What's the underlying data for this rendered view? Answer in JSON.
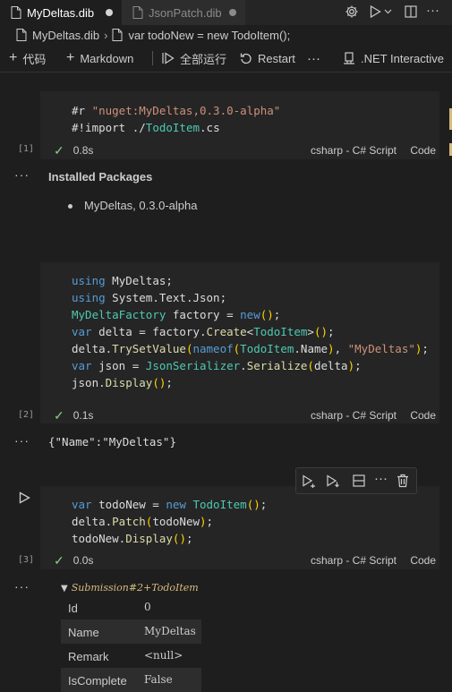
{
  "tabs": [
    {
      "label": "MyDeltas.dib",
      "active": true,
      "modified": true
    },
    {
      "label": "JsonPatch.dib",
      "active": false,
      "modified": true
    }
  ],
  "tab_actions": {
    "gear": "gear-icon",
    "run": "run-icon",
    "split": "split-editor-icon",
    "more": "more-icon"
  },
  "breadcrumb": {
    "file": "MyDeltas.dib",
    "symbol": "var todoNew = new TodoItem();"
  },
  "toolbar": {
    "code_label": "代码",
    "markdown_label": "Markdown",
    "run_all_label": "全部运行",
    "restart_label": "Restart",
    "more": "···",
    "kernel_label": ".NET Interactive"
  },
  "cells": [
    {
      "number": "[1]",
      "lines": [
        "#r \"nuget:MyDeltas,0.3.0-alpha\"",
        "#!import ./TodoItem.cs"
      ],
      "time": "0.8s",
      "language": "csharp - C# Script",
      "cell_type": "Code"
    },
    {
      "number": "[2]",
      "lines": [
        "using MyDeltas;",
        "using System.Text.Json;",
        "MyDeltaFactory factory = new();",
        "var delta = factory.Create<TodoItem>();",
        "delta.TrySetValue(nameof(TodoItem.Name), \"MyDeltas\");",
        "var json = JsonSerializer.Serialize(delta);",
        "json.Display();"
      ],
      "time": "0.1s",
      "language": "csharp - C# Script",
      "cell_type": "Code"
    },
    {
      "number": "[3]",
      "lines": [
        "var todoNew = new TodoItem();",
        "delta.Patch(todoNew);",
        "todoNew.Display();"
      ],
      "time": "0.0s",
      "language": "csharp - C# Script",
      "cell_type": "Code"
    }
  ],
  "outputs": {
    "installed_packages_title": "Installed Packages",
    "installed_packages": [
      "MyDeltas, 0.3.0-alpha"
    ],
    "json_output": "{\"Name\":\"MyDeltas\"}",
    "submission_title": "Submission#2+TodoItem",
    "submission_rows": [
      {
        "key": "Id",
        "value": "0"
      },
      {
        "key": "Name",
        "value": "MyDeltas"
      },
      {
        "key": "Remark",
        "value": "<null>"
      },
      {
        "key": "IsComplete",
        "value": "False"
      }
    ]
  },
  "ellipsis": "···",
  "colors": {
    "background": "#1e1e1e",
    "cell": "#252526",
    "success": "#89d185",
    "marker": "#d7ba7d"
  }
}
